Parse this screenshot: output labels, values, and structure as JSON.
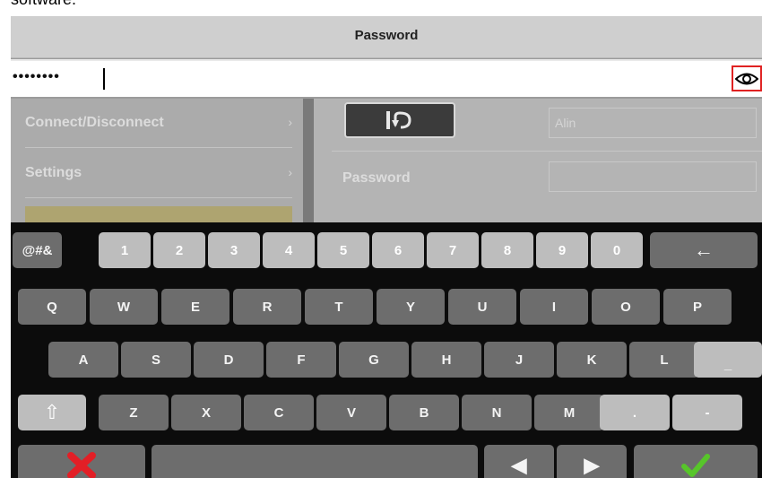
{
  "header_text_cut": "software.",
  "dialog": {
    "title": "Password",
    "password_masked": "••••••••",
    "show_password_icon": "eye-icon"
  },
  "menu": {
    "items": [
      {
        "label": "Connect/Disconnect",
        "chevron": "›"
      },
      {
        "label": "Settings",
        "chevron": "›"
      }
    ]
  },
  "form": {
    "undo_icon": "undo-icon",
    "username": "Alin",
    "password_label": "Password"
  },
  "keyboard": {
    "row1": [
      "@#&",
      "1",
      "2",
      "3",
      "4",
      "5",
      "6",
      "7",
      "8",
      "9",
      "0"
    ],
    "backspace": "←",
    "row2": [
      "Q",
      "W",
      "E",
      "R",
      "T",
      "Y",
      "U",
      "I",
      "O",
      "P"
    ],
    "row3": [
      "A",
      "S",
      "D",
      "F",
      "G",
      "H",
      "J",
      "K",
      "L",
      "_"
    ],
    "shift": "⇧",
    "row4": [
      "Z",
      "X",
      "C",
      "V",
      "B",
      "N",
      "M",
      ".",
      "-"
    ],
    "cancel_icon": "x-icon",
    "left_arrow": "◀",
    "right_arrow": "▶",
    "confirm_icon": "check-icon"
  },
  "colors": {
    "cancel": "#e21f26",
    "confirm": "#57c52a",
    "highlight": "#e02222"
  }
}
